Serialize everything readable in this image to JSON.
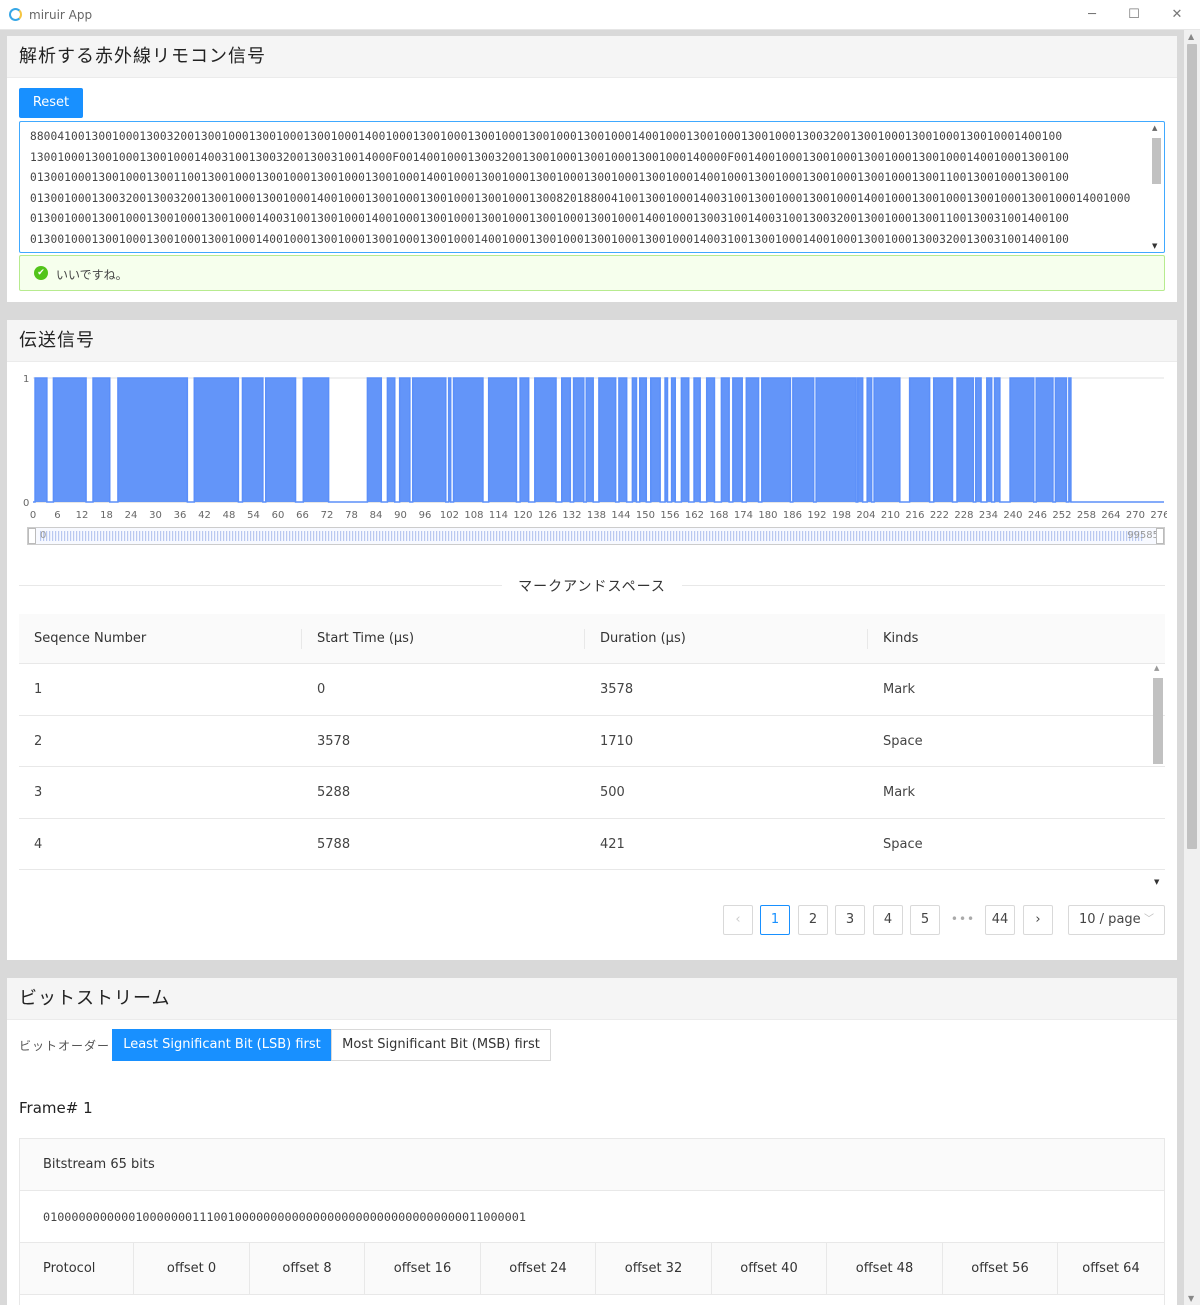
{
  "window": {
    "title": "miruir App",
    "minimize": "─",
    "maximize": "☐",
    "close": "✕"
  },
  "card1": {
    "title": "解析する赤外線リモコン信号",
    "reset_label": "Reset",
    "signal_lines": [
      "8800410013001000130032001300100013001000130010001400100013001000130010001300100013001000140010001300100013001000130032001300100013001000130010001400100",
      "13001000130010001300100014003100130032001300310014000F001400100013003200130010001300100013001000140000F0014001000130010001300100013001000140010001300100",
      "01300100013001000130011001300100013001000130010001300100014001000130010001300100013001000130010001400100013001000130010001300100013001100130010001300100",
      "01300100013003200130032001300100013001000140010001300100013001000130010001300820188004100130010001400310013001000130010001400100013001000130010001300100014001000",
      "01300100013001000130010001300100014003100130010001400100013001000130010001300100013001000140010001300310014003100130032001300100013001100130031001400100",
      "01300100013001000130010001300100014001000130010001300100013001000140010001300100013001000130010001400310013001000140010001300100013003200130031001400100"
    ],
    "status_icon": "check-circle-icon",
    "status_text": "いいですね。"
  },
  "card2": {
    "title": "伝送信号",
    "chart_data": {
      "type": "area",
      "title": "",
      "xlabel": "",
      "ylabel": "",
      "ylim": [
        0,
        1
      ],
      "y_ticks": [
        "0",
        "1"
      ],
      "x_ticks": [
        "0",
        "6",
        "12",
        "18",
        "24",
        "30",
        "36",
        "42",
        "48",
        "54",
        "60",
        "66",
        "72",
        "78",
        "84",
        "90",
        "96",
        "102",
        "108",
        "114",
        "120",
        "126",
        "132",
        "138",
        "144",
        "150",
        "156",
        "162",
        "168",
        "174",
        "180",
        "186",
        "192",
        "198",
        "204",
        "210",
        "216",
        "222",
        "228",
        "234",
        "240",
        "246",
        "252",
        "258",
        "264",
        "270",
        "276"
      ],
      "xlim": [
        0,
        277
      ],
      "color": "#5b8ff9",
      "fill": "#5b8ff9",
      "high_segments": [
        [
          0.5,
          3.4
        ],
        [
          5,
          13
        ],
        [
          14.7,
          18.8
        ],
        [
          20.8,
          37.8
        ],
        [
          39.5,
          50.3
        ],
        [
          51.3,
          56.3
        ],
        [
          57,
          64.3
        ],
        [
          66.2,
          72.4
        ],
        [
          81.9,
          85.3
        ],
        [
          86.8,
          88.6
        ],
        [
          89.8,
          92.3
        ],
        [
          93,
          101.1
        ],
        [
          101.8,
          102.3
        ],
        [
          103,
          110.2
        ],
        [
          111.6,
          118.4
        ],
        [
          119.3,
          121.4
        ],
        [
          122.9,
          128.1
        ],
        [
          129.5,
          131.6
        ],
        [
          132.4,
          134.9
        ],
        [
          135.5,
          137.2
        ],
        [
          138.6,
          142.7
        ],
        [
          143.5,
          145.4
        ],
        [
          146.8,
          147.8
        ],
        [
          148.6,
          150.2
        ],
        [
          151.3,
          153.6
        ],
        [
          154.8,
          155.4
        ],
        [
          156.4,
          157.3
        ],
        [
          158.8,
          160.6
        ],
        [
          161.9,
          163.4
        ],
        [
          165,
          166.9
        ],
        [
          168.6,
          170.5
        ],
        [
          171.4,
          173.7
        ],
        [
          174.7,
          177.7
        ],
        [
          178.5,
          185.5
        ],
        [
          186.1,
          191.2
        ],
        [
          191.8,
          201.6
        ],
        [
          202,
          203.2
        ],
        [
          204.3,
          205.4
        ],
        [
          206,
          212.3
        ],
        [
          214.7,
          219.6
        ],
        [
          220.6,
          225.2
        ],
        [
          226.3,
          230.3
        ],
        [
          230.9,
          232.2
        ],
        [
          233.6,
          234.8
        ],
        [
          235.5,
          236.8
        ],
        [
          239.3,
          245.1
        ],
        [
          245.7,
          249.8
        ],
        [
          250.4,
          253.1
        ],
        [
          253.7,
          254.2
        ]
      ],
      "range_min": "0",
      "range_max": "99585"
    },
    "divider_title": "マークアンドスペース",
    "table": {
      "columns": [
        "Seqence Number",
        "Start Time (μs)",
        "Duration (μs)",
        "Kinds"
      ],
      "rows": [
        [
          "1",
          "0",
          "3578",
          "Mark"
        ],
        [
          "2",
          "3578",
          "1710",
          "Space"
        ],
        [
          "3",
          "5288",
          "500",
          "Mark"
        ],
        [
          "4",
          "5788",
          "421",
          "Space"
        ]
      ]
    },
    "pagination": {
      "prev": "‹",
      "next": "›",
      "pages": [
        "1",
        "2",
        "3",
        "4",
        "5"
      ],
      "ellipsis": "•••",
      "last": "44",
      "current": "1",
      "page_size": "10 / page",
      "page_size_icon": "chevron-down-icon"
    }
  },
  "card3": {
    "title": "ビットストリーム",
    "order_label": "ビットオーダー",
    "lsb_label": "Least Significant Bit (LSB) first",
    "msb_label": "Most Significant Bit (MSB) first",
    "frame_title": "Frame# 1",
    "bitstream_header": "Bitstream 65 bits",
    "bitstream": "01000000000001000000011100100000000000000000000000000000000011000001",
    "offset_headers": [
      "Protocol",
      "offset 0",
      "offset 8",
      "offset 16",
      "offset 24",
      "offset 32",
      "offset 40",
      "offset 48",
      "offset 56",
      "offset 64"
    ]
  }
}
